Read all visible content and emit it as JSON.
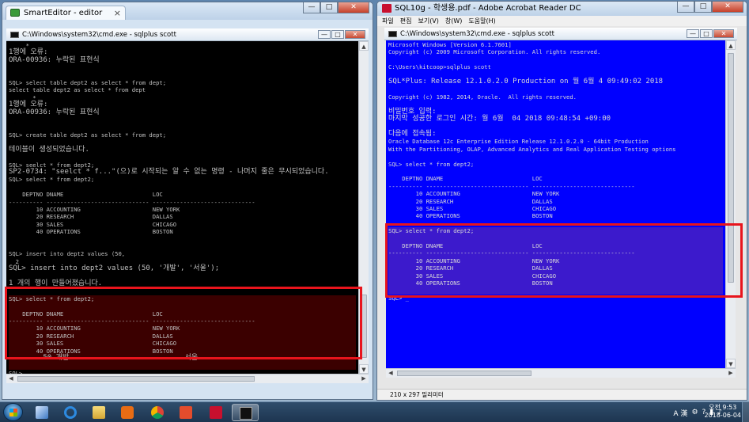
{
  "left_window": {
    "title": "SmartEditor - editor",
    "cmd_title": "C:\\Windows\\system32\\cmd.exe - sqlplus  scott",
    "console_lines": [
      "     *",
      "1행에 오류:",
      "ORA-00936: 누락된 표현식",
      "",
      "",
      "SQL> select table dept2 as select * from dept;",
      "select table dept2 as select * from dept",
      "       *",
      "1행에 오류:",
      "ORA-00936: 누락된 표현식",
      "",
      "",
      "SQL> create table dept2 as select * from dept;",
      "",
      "테이블이 생성되었습니다.",
      "",
      "SQL> seelct * from dept2;",
      "SP2-0734: \"seelct * f...\"(으)로 시작되는 알 수 없는 명령 - 나머지 줄은 무시되었습니다.",
      "SQL> select * from dept2;",
      "",
      "    DEPTNO DNAME                          LOC",
      "---------- ------------------------------ ------------------------------",
      "        10 ACCOUNTING                     NEW YORK",
      "        20 RESEARCH                       DALLAS",
      "        30 SALES                          CHICAGO",
      "        40 OPERATIONS                     BOSTON",
      "",
      "",
      "SQL> insert into dept2 values (50,",
      "  2",
      "SQL> insert into dept2 values (50, '개발', '서울');",
      "",
      "1 개의 행이 만들어졌습니다.",
      "",
      "SQL> select * from dept2;",
      "",
      "    DEPTNO DNAME                          LOC",
      "---------- ------------------------------ ------------------------------",
      "        10 ACCOUNTING                     NEW YORK",
      "        20 RESEARCH                       DALLAS",
      "        30 SALES                          CHICAGO",
      "        40 OPERATIONS                     BOSTON",
      "        50 개발                           서울",
      "",
      "SQL>"
    ]
  },
  "right_window": {
    "title": "SQL10g - 학생용.pdf - Adobe Acrobat Reader DC",
    "menu": [
      "파일",
      "편집",
      "보기(V)",
      "창(W)",
      "도움말(H)"
    ],
    "cmd_title": "C:\\Windows\\system32\\cmd.exe - sqlplus  scott",
    "console_lines": [
      "Microsoft Windows [Version 6.1.7601]",
      "Copyright (c) 2009 Microsoft Corporation. All rights reserved.",
      "",
      "C:\\Users\\kitcoop>sqlplus scott",
      "",
      "SQL*Plus: Release 12.1.0.2.0 Production on 월 6월 4 09:49:02 2018",
      "",
      "Copyright (c) 1982, 2014, Oracle.  All rights reserved.",
      "",
      "비밀번호 입력:",
      "마지막 성공한 로그인 시간: 월 6월  04 2018 09:48:54 +09:00",
      "",
      "다음에 접속됨:",
      "Oracle Database 12c Enterprise Edition Release 12.1.0.2.0 - 64bit Production",
      "With the Partitioning, OLAP, Advanced Analytics and Real Application Testing options",
      "",
      "SQL> select * from dept2;",
      "",
      "    DEPTNO DNAME                          LOC",
      "---------- ------------------------------ ------------------------------",
      "        10 ACCOUNTING                     NEW YORK",
      "        20 RESEARCH                       DALLAS",
      "        30 SALES                          CHICAGO",
      "        40 OPERATIONS                     BOSTON",
      "",
      "SQL> select * from dept2;",
      "",
      "    DEPTNO DNAME                          LOC",
      "---------- ------------------------------ ------------------------------",
      "        10 ACCOUNTING                     NEW YORK",
      "        20 RESEARCH                       DALLAS",
      "        30 SALES                          CHICAGO",
      "        40 OPERATIONS                     BOSTON",
      "",
      "SQL> _"
    ],
    "status_text": "210 x 297 밀리미터"
  },
  "taskbar": {
    "tray_lang": "A 漢",
    "time": "오전 9:53",
    "date": "2018-06-04"
  },
  "colors": {
    "left_console_bg": "#000000",
    "left_console_fg": "#c0c0c0",
    "left_highlight_bg": "#3b0000",
    "right_console_bg": "#0000ff",
    "right_console_fg": "#d8d8d8",
    "right_highlight_bg": "#3c1acc",
    "highlight_border": "#e8141c"
  },
  "icons": [
    "smarteditor-icon",
    "pdf-icon",
    "cmd-icon",
    "start-icon",
    "explorer-icon",
    "ie-icon",
    "folder-icon",
    "media-icon",
    "chrome-icon",
    "hwp-icon",
    "acrobat-icon"
  ]
}
